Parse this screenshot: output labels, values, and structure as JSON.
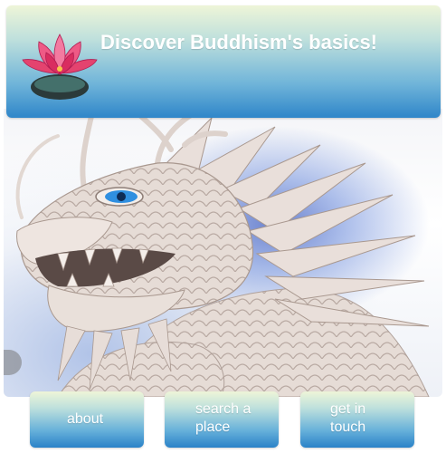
{
  "header": {
    "title": "Discover Buddhism's basics!",
    "logo_icon": "lotus-flower-icon"
  },
  "hero": {
    "image_icon": "dragon-statue-image"
  },
  "nav": {
    "about_label": "about",
    "search_label": "search a\nplace",
    "contact_label": "get in\ntouch"
  },
  "colors": {
    "banner_top": "#eef5d8",
    "banner_bottom": "#2f86c9",
    "lotus": "#e8376f",
    "dragon_eye": "#2f8fe0"
  }
}
